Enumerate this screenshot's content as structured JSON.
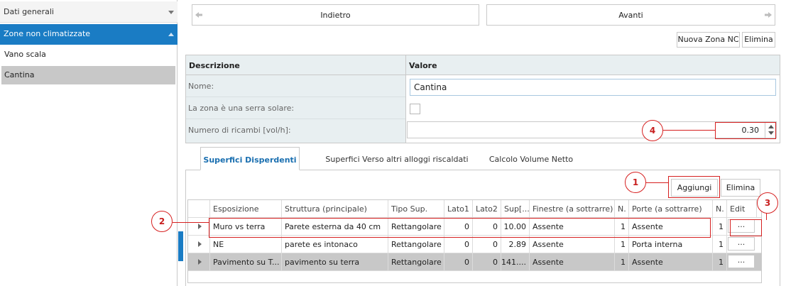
{
  "sidebar": {
    "section_general": "Dati generali",
    "section_zones": "Zone non climatizzate",
    "items": [
      {
        "label": "Vano scala"
      },
      {
        "label": "Cantina"
      }
    ]
  },
  "nav": {
    "back_label": "Indietro",
    "forward_label": "Avanti"
  },
  "toolbar": {
    "new_zone_label": "Nuova Zona NC",
    "delete_label": "Elimina"
  },
  "properties": {
    "col_description": "Descrizione",
    "col_value": "Valore",
    "rows": [
      {
        "label": "Nome:",
        "value": "Cantina"
      },
      {
        "label": "La zona è una serra solare:",
        "checked": false
      },
      {
        "label": "Numero di ricambi [vol/h]:",
        "value": "0.30"
      }
    ]
  },
  "tabs": [
    {
      "label": "Superfici Disperdenti",
      "active": true
    },
    {
      "label": "Superfici Verso altri alloggi riscaldati",
      "active": false
    },
    {
      "label": "Calcolo Volume Netto",
      "active": false
    }
  ],
  "grid_toolbar": {
    "add_label": "Aggiungi",
    "delete_label": "Elimina"
  },
  "grid": {
    "headers": [
      "Esposizione",
      "Struttura (principale)",
      "Tipo Sup.",
      "Lato1",
      "Lato2",
      "Sup[...",
      "Finestre (a sottrarre)",
      "N.",
      "Porte (a sottrarre)",
      "N.",
      "Edit"
    ],
    "rows": [
      [
        "Muro vs terra",
        "Parete esterna da 40 cm",
        "Rettangolare",
        "0",
        "0",
        "10.00",
        "Assente",
        "1",
        "Assente",
        "1",
        "..."
      ],
      [
        "NE",
        "parete es intonaco",
        "Rettangolare",
        "0",
        "0",
        "2.89",
        "Assente",
        "1",
        "Porta interna",
        "1",
        "..."
      ],
      [
        "Pavimento su T...",
        "pavimento su terra",
        "Rettangolare",
        "0",
        "0",
        "141....",
        "Assente",
        "1",
        "Assente",
        "1",
        "..."
      ]
    ],
    "selected_row": 2
  },
  "annotations": [
    "1",
    "2",
    "3",
    "4"
  ],
  "colors": {
    "accent": "#1a7cc4",
    "annotation": "#d62020",
    "selection": "#c8c8c8",
    "grid_header": "#e8eff1"
  }
}
